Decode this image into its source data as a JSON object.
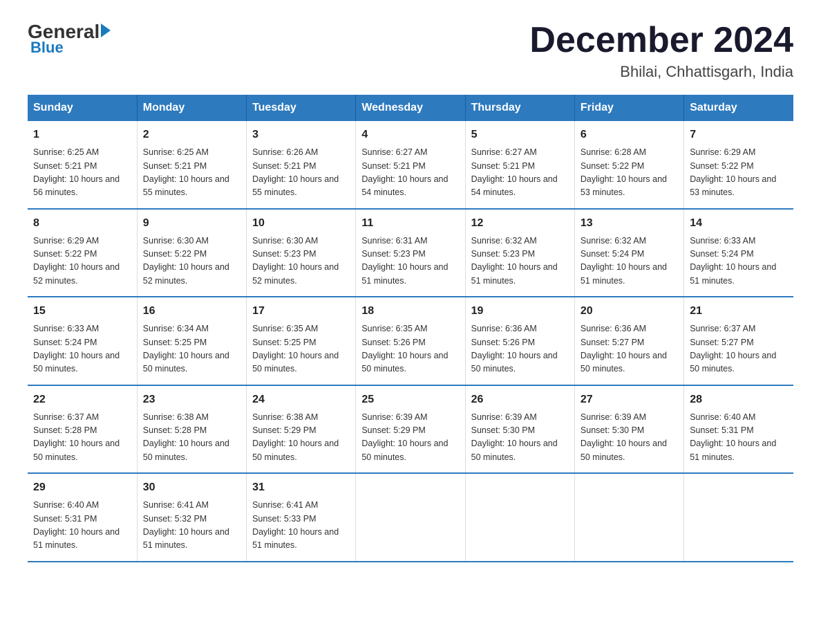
{
  "header": {
    "logo_general": "General",
    "logo_blue": "Blue",
    "month_title": "December 2024",
    "location": "Bhilai, Chhattisgarh, India"
  },
  "days_of_week": [
    "Sunday",
    "Monday",
    "Tuesday",
    "Wednesday",
    "Thursday",
    "Friday",
    "Saturday"
  ],
  "weeks": [
    [
      {
        "day": "1",
        "sunrise": "6:25 AM",
        "sunset": "5:21 PM",
        "daylight": "10 hours and 56 minutes."
      },
      {
        "day": "2",
        "sunrise": "6:25 AM",
        "sunset": "5:21 PM",
        "daylight": "10 hours and 55 minutes."
      },
      {
        "day": "3",
        "sunrise": "6:26 AM",
        "sunset": "5:21 PM",
        "daylight": "10 hours and 55 minutes."
      },
      {
        "day": "4",
        "sunrise": "6:27 AM",
        "sunset": "5:21 PM",
        "daylight": "10 hours and 54 minutes."
      },
      {
        "day": "5",
        "sunrise": "6:27 AM",
        "sunset": "5:21 PM",
        "daylight": "10 hours and 54 minutes."
      },
      {
        "day": "6",
        "sunrise": "6:28 AM",
        "sunset": "5:22 PM",
        "daylight": "10 hours and 53 minutes."
      },
      {
        "day": "7",
        "sunrise": "6:29 AM",
        "sunset": "5:22 PM",
        "daylight": "10 hours and 53 minutes."
      }
    ],
    [
      {
        "day": "8",
        "sunrise": "6:29 AM",
        "sunset": "5:22 PM",
        "daylight": "10 hours and 52 minutes."
      },
      {
        "day": "9",
        "sunrise": "6:30 AM",
        "sunset": "5:22 PM",
        "daylight": "10 hours and 52 minutes."
      },
      {
        "day": "10",
        "sunrise": "6:30 AM",
        "sunset": "5:23 PM",
        "daylight": "10 hours and 52 minutes."
      },
      {
        "day": "11",
        "sunrise": "6:31 AM",
        "sunset": "5:23 PM",
        "daylight": "10 hours and 51 minutes."
      },
      {
        "day": "12",
        "sunrise": "6:32 AM",
        "sunset": "5:23 PM",
        "daylight": "10 hours and 51 minutes."
      },
      {
        "day": "13",
        "sunrise": "6:32 AM",
        "sunset": "5:24 PM",
        "daylight": "10 hours and 51 minutes."
      },
      {
        "day": "14",
        "sunrise": "6:33 AM",
        "sunset": "5:24 PM",
        "daylight": "10 hours and 51 minutes."
      }
    ],
    [
      {
        "day": "15",
        "sunrise": "6:33 AM",
        "sunset": "5:24 PM",
        "daylight": "10 hours and 50 minutes."
      },
      {
        "day": "16",
        "sunrise": "6:34 AM",
        "sunset": "5:25 PM",
        "daylight": "10 hours and 50 minutes."
      },
      {
        "day": "17",
        "sunrise": "6:35 AM",
        "sunset": "5:25 PM",
        "daylight": "10 hours and 50 minutes."
      },
      {
        "day": "18",
        "sunrise": "6:35 AM",
        "sunset": "5:26 PM",
        "daylight": "10 hours and 50 minutes."
      },
      {
        "day": "19",
        "sunrise": "6:36 AM",
        "sunset": "5:26 PM",
        "daylight": "10 hours and 50 minutes."
      },
      {
        "day": "20",
        "sunrise": "6:36 AM",
        "sunset": "5:27 PM",
        "daylight": "10 hours and 50 minutes."
      },
      {
        "day": "21",
        "sunrise": "6:37 AM",
        "sunset": "5:27 PM",
        "daylight": "10 hours and 50 minutes."
      }
    ],
    [
      {
        "day": "22",
        "sunrise": "6:37 AM",
        "sunset": "5:28 PM",
        "daylight": "10 hours and 50 minutes."
      },
      {
        "day": "23",
        "sunrise": "6:38 AM",
        "sunset": "5:28 PM",
        "daylight": "10 hours and 50 minutes."
      },
      {
        "day": "24",
        "sunrise": "6:38 AM",
        "sunset": "5:29 PM",
        "daylight": "10 hours and 50 minutes."
      },
      {
        "day": "25",
        "sunrise": "6:39 AM",
        "sunset": "5:29 PM",
        "daylight": "10 hours and 50 minutes."
      },
      {
        "day": "26",
        "sunrise": "6:39 AM",
        "sunset": "5:30 PM",
        "daylight": "10 hours and 50 minutes."
      },
      {
        "day": "27",
        "sunrise": "6:39 AM",
        "sunset": "5:30 PM",
        "daylight": "10 hours and 50 minutes."
      },
      {
        "day": "28",
        "sunrise": "6:40 AM",
        "sunset": "5:31 PM",
        "daylight": "10 hours and 51 minutes."
      }
    ],
    [
      {
        "day": "29",
        "sunrise": "6:40 AM",
        "sunset": "5:31 PM",
        "daylight": "10 hours and 51 minutes."
      },
      {
        "day": "30",
        "sunrise": "6:41 AM",
        "sunset": "5:32 PM",
        "daylight": "10 hours and 51 minutes."
      },
      {
        "day": "31",
        "sunrise": "6:41 AM",
        "sunset": "5:33 PM",
        "daylight": "10 hours and 51 minutes."
      },
      null,
      null,
      null,
      null
    ]
  ]
}
